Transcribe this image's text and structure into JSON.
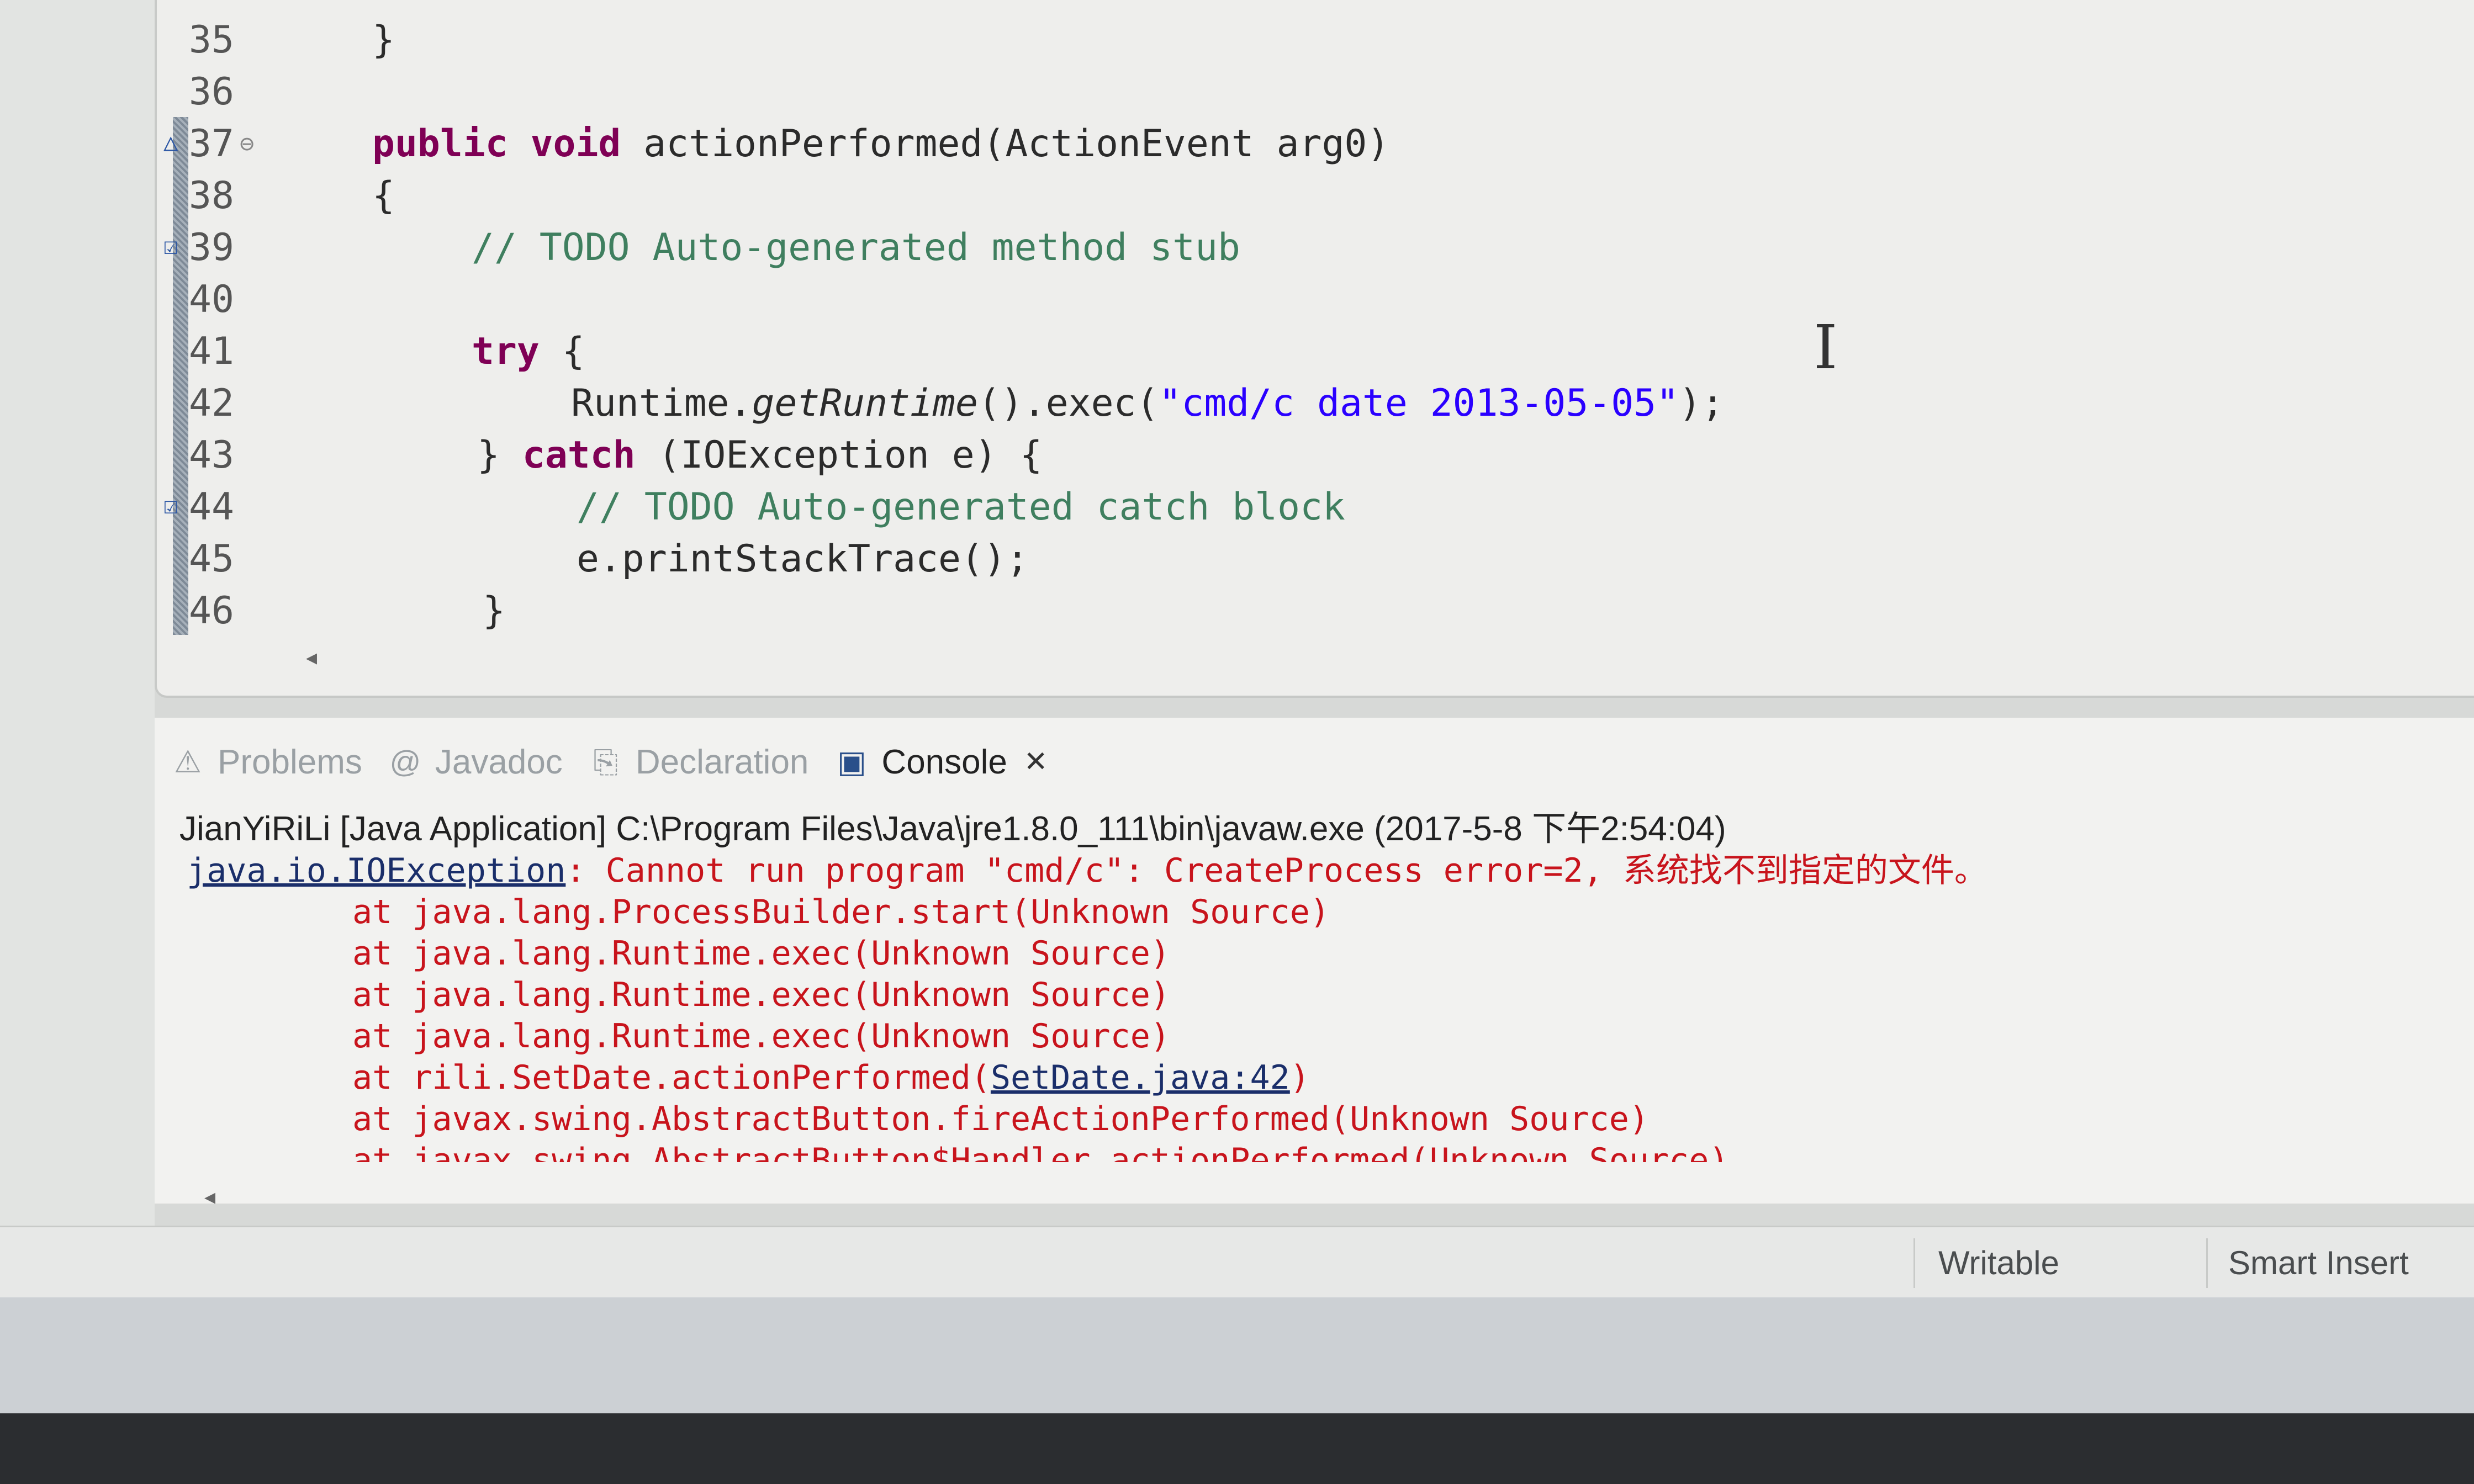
{
  "editor": {
    "lines": [
      {
        "num": "35",
        "text": "}"
      },
      {
        "num": "36",
        "text": ""
      },
      {
        "num": "37",
        "kw": "public void ",
        "text": "actionPerformed(ActionEvent arg0)",
        "fold": "⊖"
      },
      {
        "num": "38",
        "text": "{"
      },
      {
        "num": "39",
        "comment": "// TODO Auto-generated method stub",
        "task": true
      },
      {
        "num": "40",
        "text": ""
      },
      {
        "num": "41",
        "kw": "try",
        "text": " {"
      },
      {
        "num": "42",
        "pre": "Runtime.",
        "method": "getRuntime",
        "post": "().exec(",
        "str": "\"cmd/c date 2013-05-05\"",
        "end": ");"
      },
      {
        "num": "43",
        "pre2": "} ",
        "kw": "catch",
        "text": " (IOException e) {"
      },
      {
        "num": "44",
        "comment": "// TODO Auto-generated catch block",
        "task": true
      },
      {
        "num": "45",
        "text": "e.printStackTrace();"
      },
      {
        "num": "46",
        "text": "}"
      }
    ]
  },
  "panel": {
    "tabs": [
      {
        "label": "Problems",
        "icon": "problems-icon"
      },
      {
        "label": "Javadoc",
        "icon": "javadoc-icon"
      },
      {
        "label": "Declaration",
        "icon": "declaration-icon"
      },
      {
        "label": "Console",
        "icon": "console-icon",
        "active": true
      }
    ],
    "launch": "JianYiRiLi [Java Application] C:\\Program Files\\Java\\jre1.8.0_111\\bin\\javaw.exe (2017-5-8 下午2:54:04)",
    "exception": {
      "link": "java.io.IOException",
      "message": ": Cannot run program \"cmd/c\": CreateProcess error=2, 系统找不到指定的文件。"
    },
    "trace": [
      {
        "text": "at java.lang.ProcessBuilder.start(Unknown Source)"
      },
      {
        "text": "at java.lang.Runtime.exec(Unknown Source)"
      },
      {
        "text": "at java.lang.Runtime.exec(Unknown Source)"
      },
      {
        "text": "at java.lang.Runtime.exec(Unknown Source)"
      },
      {
        "pre": "at rili.SetDate.actionPerformed(",
        "link": "SetDate.java:42",
        "post": ")"
      },
      {
        "text": "at javax.swing.AbstractButton.fireActionPerformed(Unknown Source)"
      },
      {
        "text": "at javax.swing.AbstractButton$Handler.actionPerformed(Unknown Source)"
      }
    ]
  },
  "status": {
    "writable": "Writable",
    "insert_mode": "Smart Insert"
  }
}
